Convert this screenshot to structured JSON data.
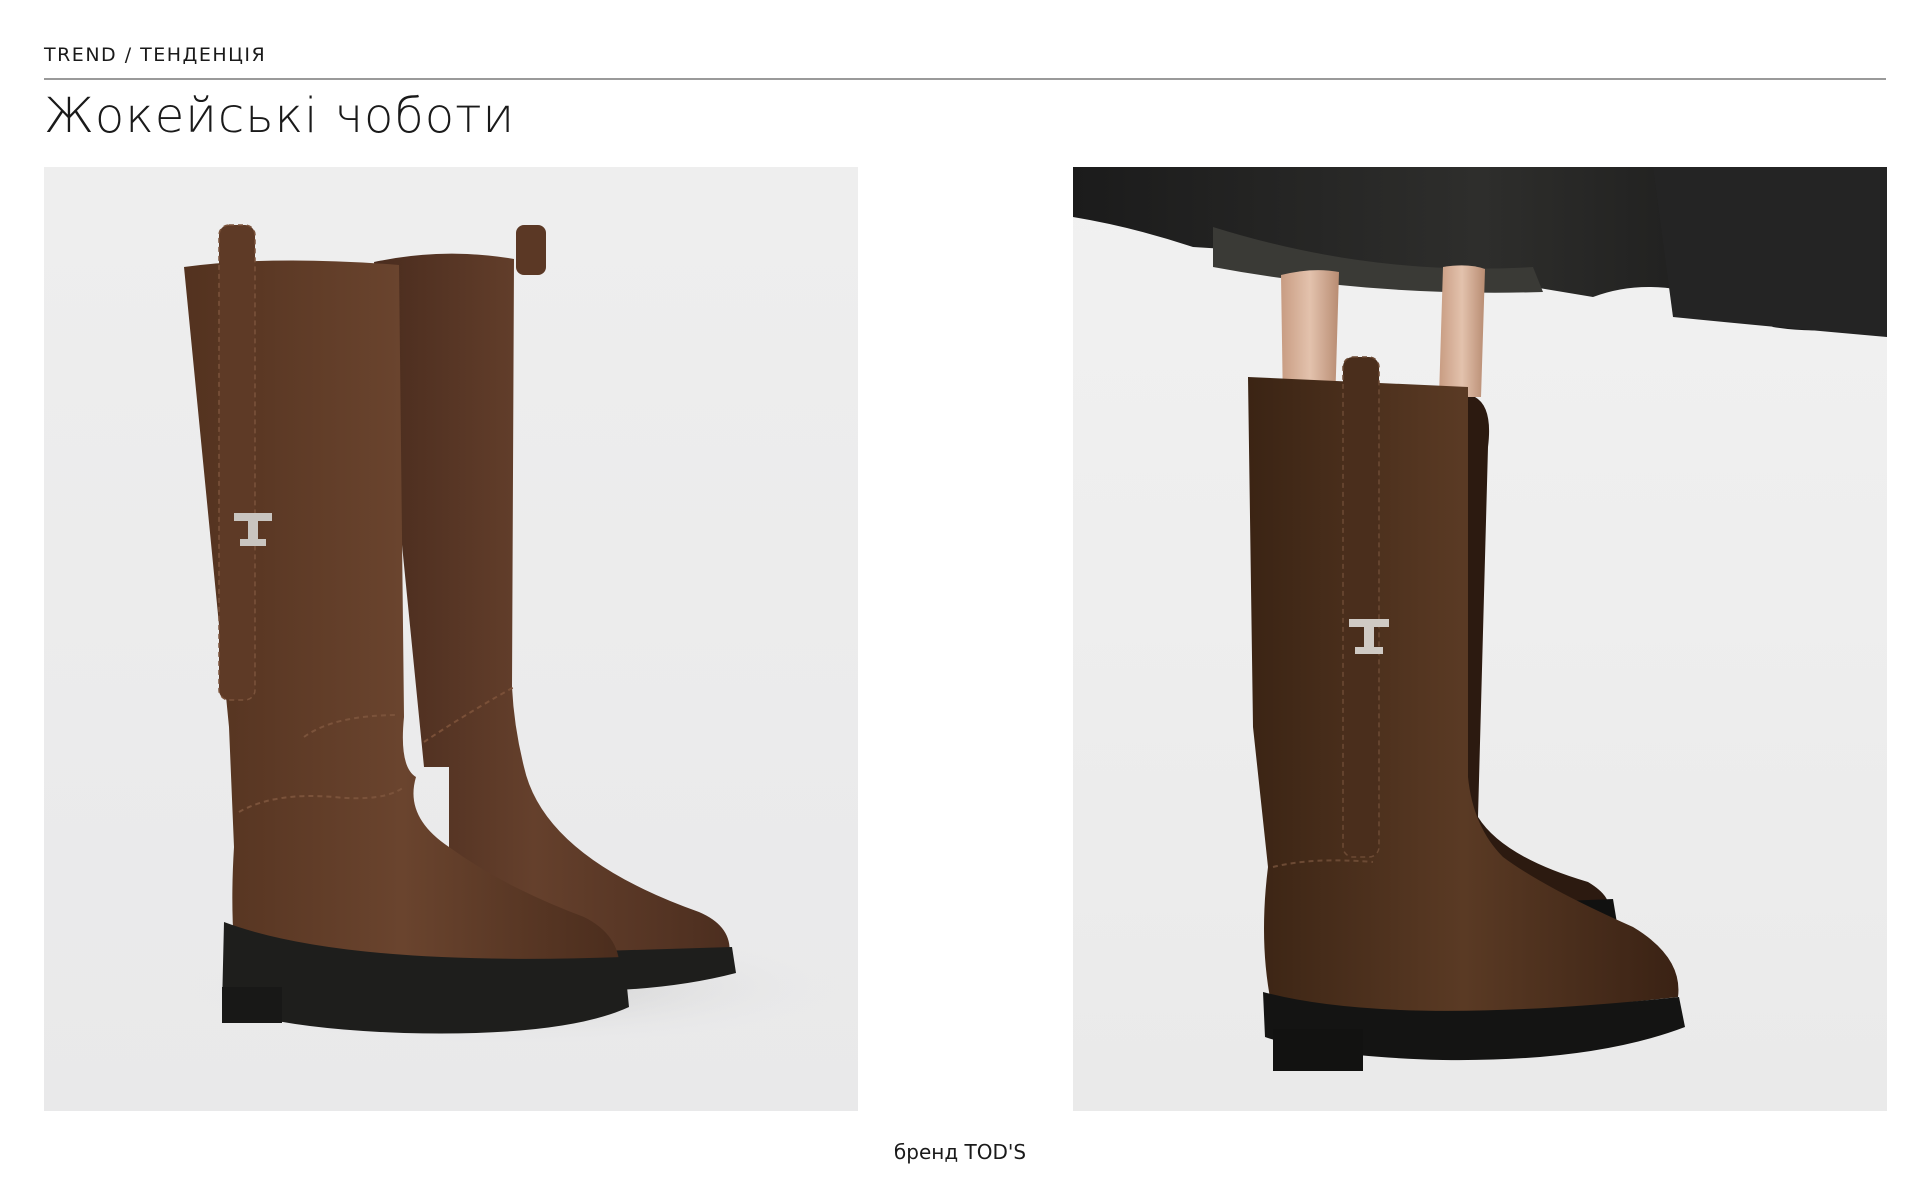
{
  "header": {
    "eyebrow": "TREND / ТЕНДЕНЦІЯ",
    "title": "Жокейські чоботи"
  },
  "images": [
    {
      "name": "boots-product-photo",
      "subject": "pair of brown suede knee-high boots with metal T logo"
    },
    {
      "name": "boots-worn-photo",
      "subject": "model wearing brown suede knee-high boots with dark coat"
    }
  ],
  "footer": {
    "caption": "бренд TOD'S"
  },
  "colors": {
    "suede": "#5a3625",
    "suede_dark": "#3f2618",
    "sole": "#1e1e1c",
    "background": "#ffffff",
    "rule": "#9a9a9a"
  }
}
